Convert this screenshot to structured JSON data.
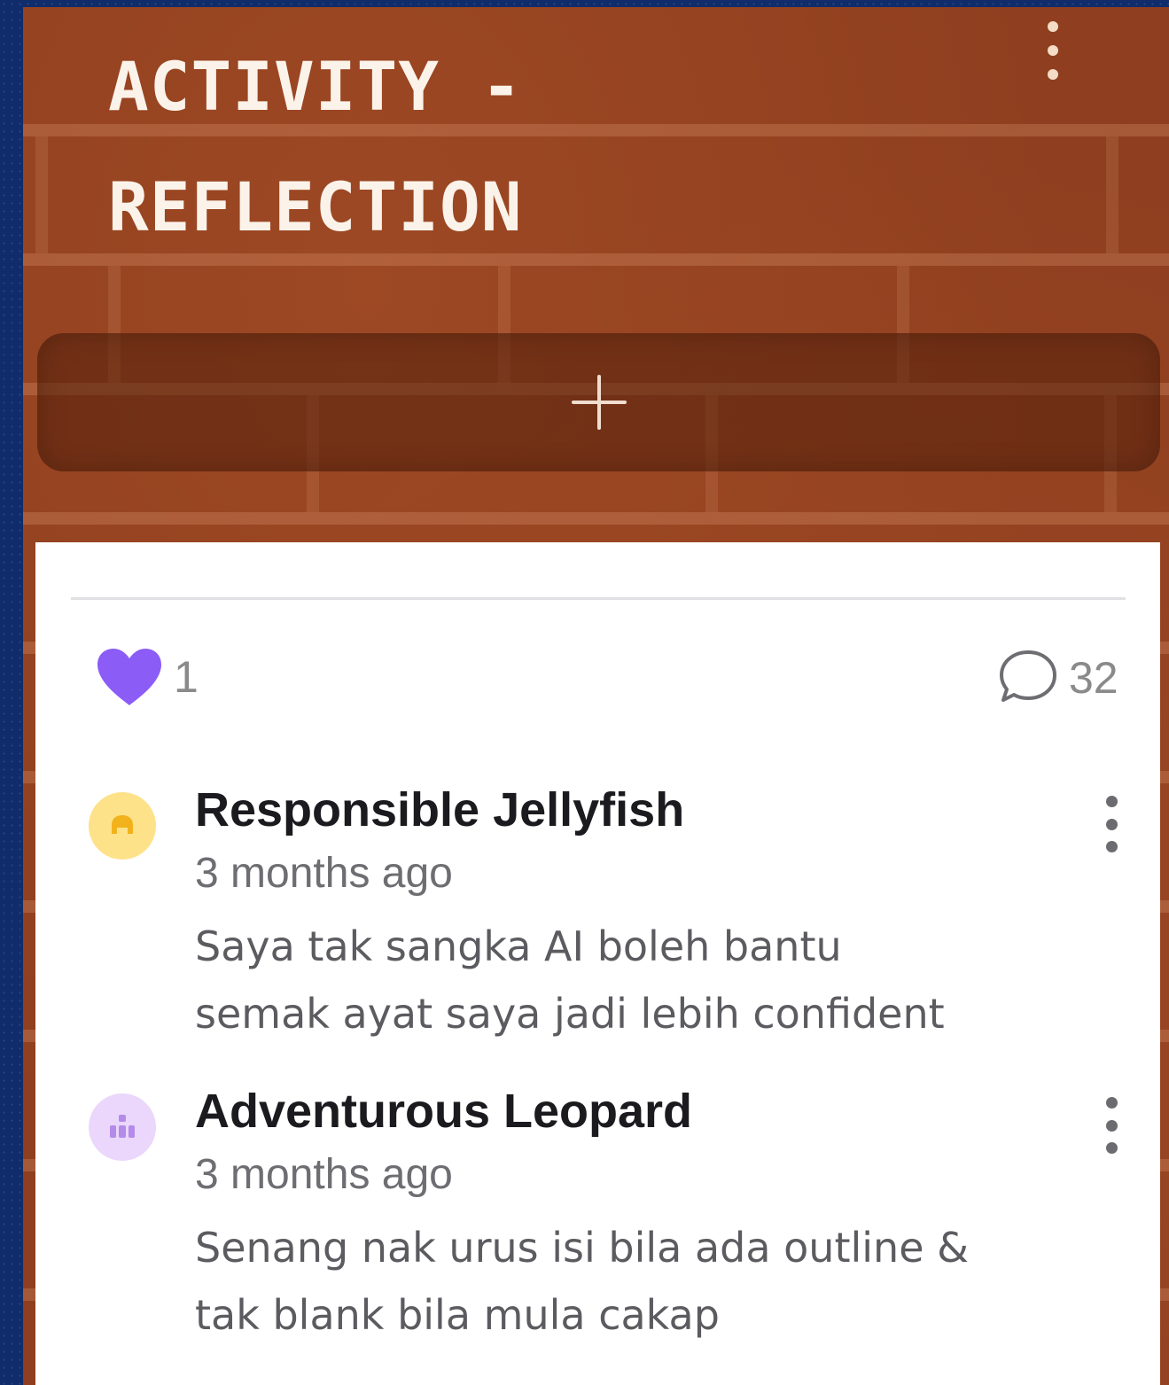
{
  "column": {
    "title_line1": "ACTIVITY -",
    "title_line2": "REFLECTION",
    "menu_icon": "more-vertical-icon",
    "add_icon": "plus-icon"
  },
  "post": {
    "likes": "1",
    "like_icon": "heart-icon",
    "like_color": "#8b5cf6",
    "comments_count": "32",
    "comment_icon": "speech-bubble-icon"
  },
  "comments": [
    {
      "author": "Responsible Jellyfish",
      "time": "3 months ago",
      "text_line1": "Saya tak sangka AI boleh bantu",
      "text_line2": "semak ayat saya jadi lebih confident",
      "avatar_bg": "#fde28a",
      "avatar_fg": "#f2b21b"
    },
    {
      "author": "Adventurous Leopard",
      "time": "3 months ago",
      "text_line1": "Senang nak urus isi bila ada outline &",
      "text_line2": "tak blank bila mula cakap",
      "avatar_bg": "#ead7fb",
      "avatar_fg": "#b48be8"
    }
  ],
  "colors": {
    "frame": "#102c6a",
    "board": "#8f3f1f",
    "card": "#ffffff"
  }
}
